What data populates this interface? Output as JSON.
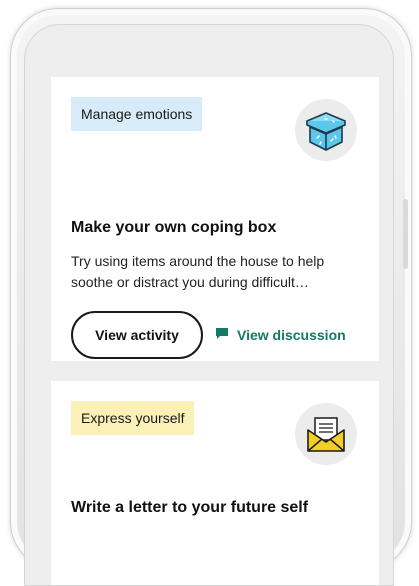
{
  "cards": [
    {
      "tag": "Manage emotions",
      "icon": "coping-box-icon",
      "title": "Make your own coping box",
      "description": "Try using items around the house to help soothe or distract you during difficult…",
      "primary_button": "View activity",
      "secondary_link": "View discussion"
    },
    {
      "tag": "Express yourself",
      "icon": "envelope-letter-icon",
      "title": "Write a letter to your future self"
    }
  ],
  "colors": {
    "tag_blue": "#d7ebf8",
    "tag_yellow": "#fbf1b6",
    "link_green": "#157a62",
    "card_background": "#ffffff",
    "screen_background": "#eeeeee"
  }
}
